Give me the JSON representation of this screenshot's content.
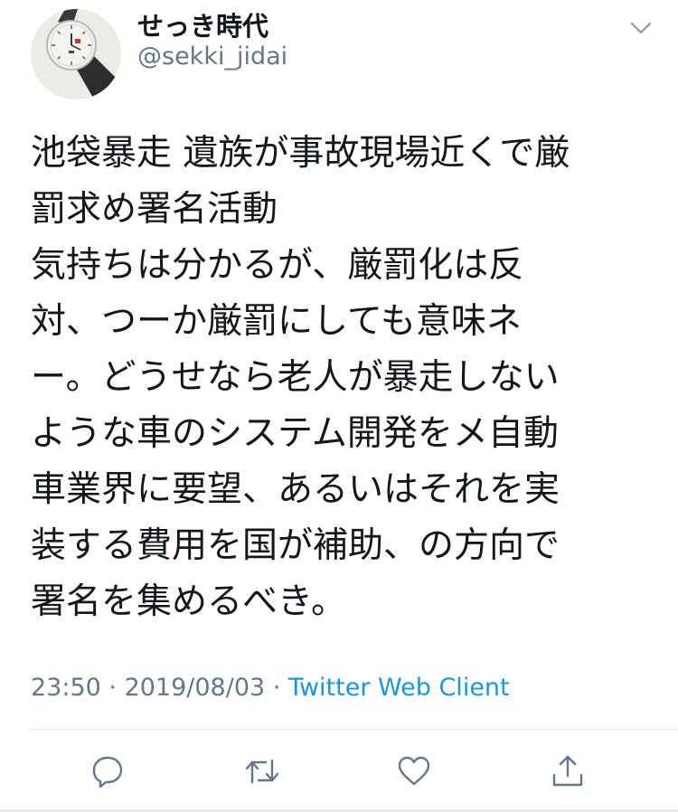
{
  "user": {
    "display_name": "せっき時代",
    "handle": "@sekki_jidai"
  },
  "tweet": {
    "lines": [
      "池袋暴走 遺族が事故現場近くで厳",
      "罰求め署名活動",
      "気持ちは分かるが、厳罰化は反",
      "対、つーか厳罰にしても意味ネ",
      "ー。どうせなら老人が暴走しない",
      "ような車のシステム開発をメ自動",
      "車業界に要望、あるいはそれを実",
      "装する費用を国が補助、の方向で",
      "署名を集めるべき。"
    ],
    "time": "23:50",
    "date": "2019/08/03",
    "separator": " · ",
    "client": "Twitter Web Client"
  },
  "icons": {
    "avatar": "watch-avatar",
    "menu": "chevron-down-icon",
    "reply": "reply-icon",
    "retweet": "retweet-icon",
    "like": "heart-icon",
    "share": "share-icon"
  },
  "colors": {
    "text": "#14171a",
    "secondary": "#657786",
    "link": "#1b95e0",
    "divider": "#e1e8ed"
  }
}
